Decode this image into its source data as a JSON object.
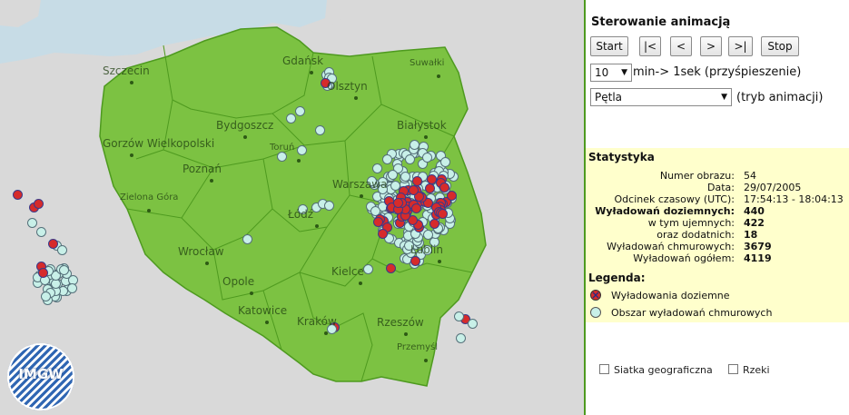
{
  "map": {
    "cities": [
      {
        "name": "Gdańsk",
        "color": "#1f3d10"
      },
      {
        "name": "Olsztyn",
        "color": "#1f3d10"
      },
      {
        "name": "Suwałki",
        "color": "#1f3d10"
      },
      {
        "name": "Szczecin",
        "color": "#1f3d10"
      },
      {
        "name": "Bydgoszcz",
        "color": "#1f3d10"
      },
      {
        "name": "Białystok",
        "color": "#1f3d10"
      },
      {
        "name": "Gorzów Wielkopolski",
        "color": "#1f3d10"
      },
      {
        "name": "Toruń",
        "color": "#1f3d10"
      },
      {
        "name": "Poznań",
        "color": "#1f3d10"
      },
      {
        "name": "Warszawa",
        "color": "#1f3d10"
      },
      {
        "name": "Zielona Góra",
        "color": "#1f3d10"
      },
      {
        "name": "Łódź",
        "color": "#1f3d10"
      },
      {
        "name": "Lublin",
        "color": "#1f3d10"
      },
      {
        "name": "Wrocław",
        "color": "#1f3d10"
      },
      {
        "name": "Kielce",
        "color": "#1f3d10"
      },
      {
        "name": "Opole",
        "color": "#1f3d10"
      },
      {
        "name": "Katowice",
        "color": "#1f3d10"
      },
      {
        "name": "Kraków",
        "color": "#1f3d10"
      },
      {
        "name": "Rzeszów",
        "color": "#1f3d10"
      },
      {
        "name": "Przemyśl",
        "color": "#1f3d10"
      }
    ],
    "logo_text": "IMGW",
    "colors": {
      "land": "#7cc242",
      "border": "#4e9a1f",
      "sea": "#c7dce6",
      "neighbor": "#d9d9d9",
      "strike": "#d62b2b",
      "cloud": "#c8f0e8"
    }
  },
  "panel": {
    "title": "Sterowanie animacją",
    "buttons": {
      "start": "Start",
      "first": "|<",
      "prev": "<",
      "next": ">",
      "last": ">|",
      "stop": "Stop"
    },
    "speed": {
      "value": "10",
      "label": "min-> 1sek (przyśpieszenie)"
    },
    "mode": {
      "value": "Pętla",
      "label": "(tryb animacji)"
    },
    "stats": {
      "title": "Statystyka",
      "rows": [
        {
          "key": "Numer obrazu:",
          "value": "54",
          "bold": false
        },
        {
          "key": "Data:",
          "value": "29/07/2005",
          "bold": false
        },
        {
          "key": "Odcinek czasowy (UTC):",
          "value": "17:54:13 - 18:04:13",
          "bold": false
        },
        {
          "key": "Wyładowań doziemnych:",
          "value": "440",
          "bold": true
        },
        {
          "key": "w tym ujemnych:",
          "value": "422",
          "bold": false
        },
        {
          "key": "oraz dodatnich:",
          "value": "18",
          "bold": false
        },
        {
          "key": "Wyładowań chmurowych:",
          "value": "3679",
          "bold": false
        },
        {
          "key": "Wyładowań ogółem:",
          "value": "4119",
          "bold": false
        }
      ],
      "legend_title": "Legenda:",
      "legend": [
        {
          "label": "Wyładowania doziemne",
          "icon": "strike-marker-icon"
        },
        {
          "label": "Obszar wyładowań chmurowych",
          "icon": "cloud-marker-icon"
        }
      ]
    },
    "checkboxes": [
      {
        "label": "Siatka geograficzna",
        "checked": false
      },
      {
        "label": "Rzeki",
        "checked": false
      }
    ]
  }
}
